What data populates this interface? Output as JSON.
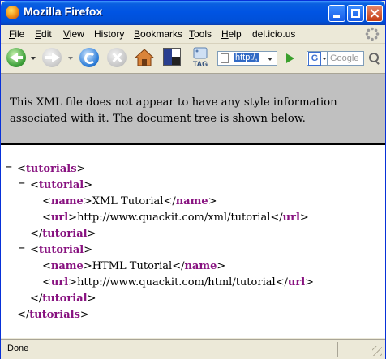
{
  "window": {
    "title": "Mozilla Firefox"
  },
  "menu": [
    {
      "label": "File",
      "u": "F",
      "rest": "ile"
    },
    {
      "label": "Edit",
      "u": "E",
      "rest": "dit"
    },
    {
      "label": "View",
      "u": "V",
      "rest": "iew"
    },
    {
      "label": "History",
      "u": "",
      "rest": "History"
    },
    {
      "label": "Bookmarks",
      "u": "B",
      "rest": "ookmarks"
    },
    {
      "label": "Tools",
      "u": "T",
      "rest": "ools"
    },
    {
      "label": "Help",
      "u": "H",
      "rest": "elp"
    },
    {
      "label": "del.icio.us",
      "u": "",
      "rest": "del.icio.us"
    }
  ],
  "toolbar": {
    "tag_label": "TAG",
    "url": "http:/,",
    "search_engine": "G",
    "search_placeholder": "Google"
  },
  "banner": {
    "text": "This XML file does not appear to have any style information associated with it. The document tree is shown below."
  },
  "xml": {
    "collapse_symbol": "−",
    "lt": "<",
    "gt": ">",
    "lt_close": "</",
    "root_tag": "tutorials",
    "child_tag": "tutorial",
    "name_tag": "name",
    "url_tag": "url",
    "tutorials": [
      {
        "name": "XML Tutorial",
        "url": "http://www.quackit.com/xml/tutorial"
      },
      {
        "name": "HTML Tutorial",
        "url": "http://www.quackit.com/html/tutorial"
      }
    ]
  },
  "status": {
    "text": "Done"
  },
  "colors": {
    "tag": "#881280",
    "titlebar": "#0054e3",
    "banner_bg": "#c0c0c0"
  }
}
